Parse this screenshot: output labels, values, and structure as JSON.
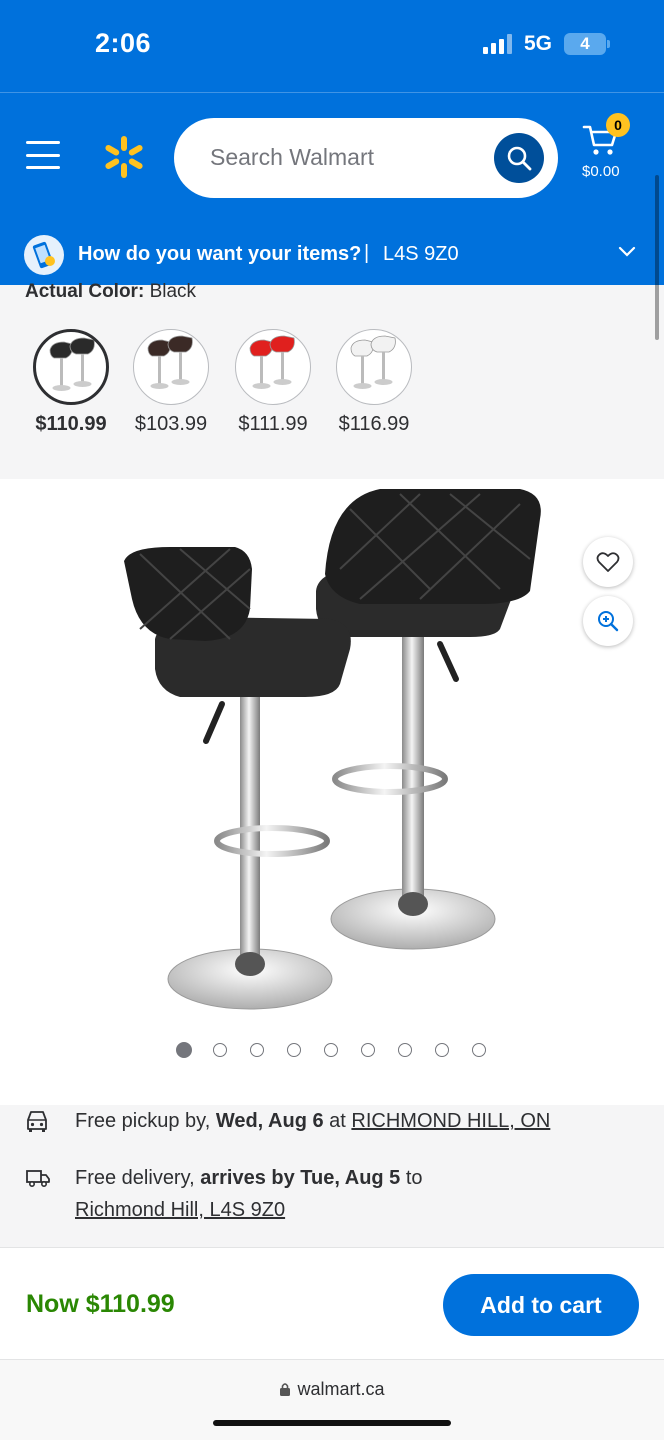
{
  "status_bar": {
    "time": "2:06",
    "network": "5G",
    "battery": "4"
  },
  "header": {
    "search_placeholder": "Search Walmart",
    "cart_count": "0",
    "cart_total": "$0.00",
    "brand_color": "#0071dc",
    "spark_color": "#ffc220"
  },
  "fulfillment_banner": {
    "prompt": "How do you want your items?",
    "divider": "|",
    "postal_code": "L4S 9Z0"
  },
  "color_picker": {
    "label": "Actual Color:",
    "value": "Black",
    "swatches": [
      {
        "color": "Black",
        "price": "$110.99",
        "selected": true,
        "seat_hex": "#2a2a2a"
      },
      {
        "color": "Brown",
        "price": "$103.99",
        "selected": false,
        "seat_hex": "#3b2a26"
      },
      {
        "color": "Red",
        "price": "$111.99",
        "selected": false,
        "seat_hex": "#e0201e"
      },
      {
        "color": "White",
        "price": "$116.99",
        "selected": false,
        "seat_hex": "#f2f2f2"
      }
    ]
  },
  "gallery": {
    "image_count": 9,
    "active_index": 0
  },
  "fulfillment_info": {
    "pickup_prefix": "Free pickup by, ",
    "pickup_date": "Wed, Aug 6",
    "pickup_at": " at ",
    "pickup_store": "RICHMOND HILL, ON",
    "delivery_prefix": "Free delivery, ",
    "delivery_date": "arrives by Tue, Aug 5",
    "delivery_to": " to",
    "delivery_location": "Richmond Hill, L4S 9Z0"
  },
  "purchase": {
    "now_price": "Now $110.99",
    "add_to_cart": "Add to cart"
  },
  "browser": {
    "url": "walmart.ca"
  }
}
